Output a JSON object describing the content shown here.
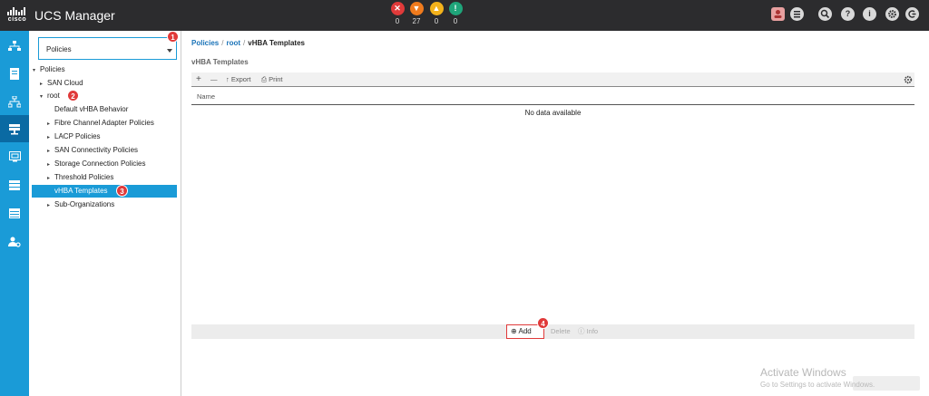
{
  "header": {
    "logo_text": "cisco",
    "title": "UCS Manager",
    "faults": [
      {
        "name": "critical",
        "glyph": "✕",
        "count": "0",
        "color": "#e03a3a"
      },
      {
        "name": "major",
        "glyph": "▼",
        "count": "27",
        "color": "#f07b1d"
      },
      {
        "name": "minor",
        "glyph": "▲",
        "count": "0",
        "color": "#f3b21b"
      },
      {
        "name": "warning",
        "glyph": "!",
        "count": "0",
        "color": "#1fa57a"
      }
    ],
    "right_icons": [
      "user-alert-icon",
      "list-icon",
      "search-icon",
      "help-icon",
      "info-icon",
      "settings-icon",
      "logout-icon"
    ]
  },
  "rail": {
    "items": [
      "equipment-icon",
      "servers-icon",
      "lan-icon",
      "san-icon",
      "vm-icon",
      "storage-icon",
      "chassis-icon",
      "admin-icon"
    ],
    "active_index": 3
  },
  "nav": {
    "dropdown_value": "Policies",
    "tree": [
      {
        "label": "Policies",
        "twisty": "▾"
      },
      {
        "label": "SAN Cloud",
        "twisty": "▸"
      },
      {
        "label": "root",
        "twisty": "▾"
      },
      {
        "label": "Default vHBA Behavior",
        "twisty": ""
      },
      {
        "label": "Fibre Channel Adapter Policies",
        "twisty": "▸"
      },
      {
        "label": "LACP Policies",
        "twisty": "▸"
      },
      {
        "label": "SAN Connectivity Policies",
        "twisty": "▸"
      },
      {
        "label": "Storage Connection Policies",
        "twisty": "▸"
      },
      {
        "label": "Threshold Policies",
        "twisty": "▸"
      },
      {
        "label": "vHBA Templates",
        "twisty": ""
      },
      {
        "label": "Sub-Organizations",
        "twisty": "▸"
      }
    ],
    "badges": [
      "1",
      "2",
      "3",
      "4"
    ]
  },
  "content": {
    "breadcrumb": [
      "Policies",
      "root",
      "vHBA Templates"
    ],
    "breadcrumb_sep": "/",
    "section_title": "vHBA Templates",
    "toolbar": {
      "add": "+",
      "remove": "—",
      "export": "Export",
      "print": "Print"
    },
    "column_header": "Name",
    "empty_message": "No data available",
    "footer": {
      "add": "Add",
      "delete": "Delete",
      "info": "Info"
    }
  },
  "watermark": {
    "line1": "Activate Windows",
    "line2": "Go to Settings to activate Windows."
  },
  "colors": {
    "accent": "#1a9bd7",
    "rail_active": "#0a6aa3",
    "badge": "#e03a3a",
    "header_bg": "#2c2c2e"
  }
}
